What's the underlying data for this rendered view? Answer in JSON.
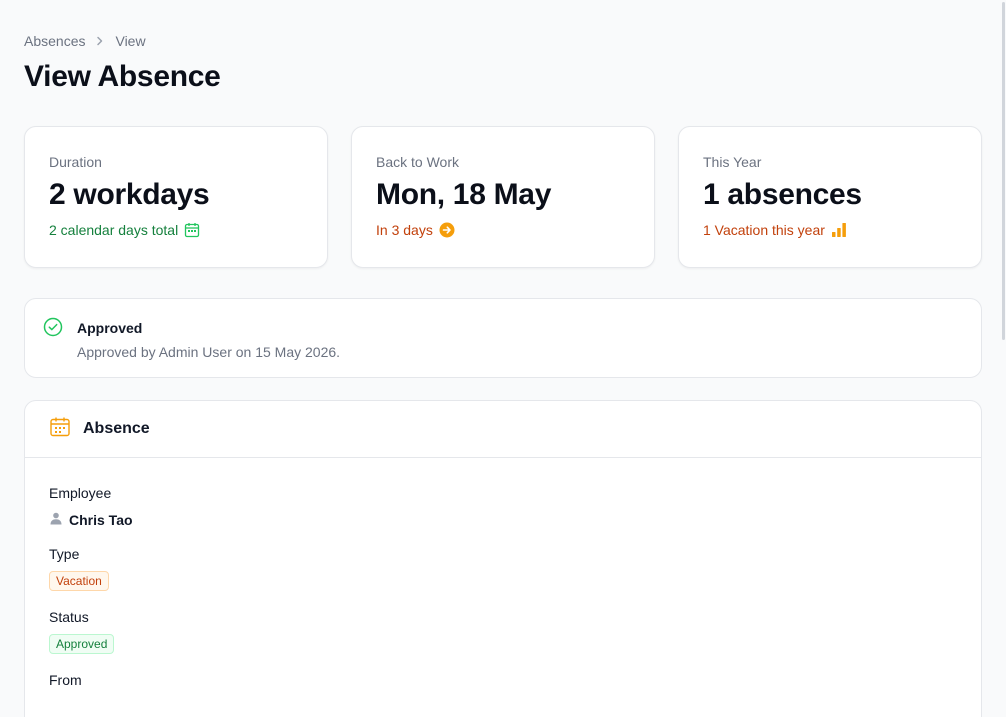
{
  "breadcrumb": {
    "items": [
      "Absences",
      "View"
    ]
  },
  "page": {
    "title": "View Absence"
  },
  "stats": [
    {
      "label": "Duration",
      "value": "2 workdays",
      "description": "2 calendar days total",
      "icon": "calendar-icon",
      "color": "#15803d"
    },
    {
      "label": "Back to Work",
      "value": "Mon, 18 May",
      "description": "In 3 days",
      "icon": "arrow-circle-right-icon",
      "color": "#f59e0b"
    },
    {
      "label": "This Year",
      "value": "1 absences",
      "description": "1 Vacation this year",
      "icon": "bar-chart-icon",
      "color": "#f59e0b"
    }
  ],
  "approval": {
    "title": "Approved",
    "text": "Approved by Admin User on 15 May 2026.",
    "icon": "check-circle-icon",
    "color": "#22c55e"
  },
  "absence_section": {
    "title": "Absence",
    "icon": "calendar-icon",
    "fields": {
      "employee": {
        "label": "Employee",
        "value": "Chris Tao",
        "icon": "user-icon"
      },
      "type": {
        "label": "Type",
        "value": "Vacation"
      },
      "status": {
        "label": "Status",
        "value": "Approved"
      },
      "from": {
        "label": "From"
      }
    }
  },
  "colors": {
    "accent_orange": "#f59e0b",
    "success_green": "#15803d"
  }
}
